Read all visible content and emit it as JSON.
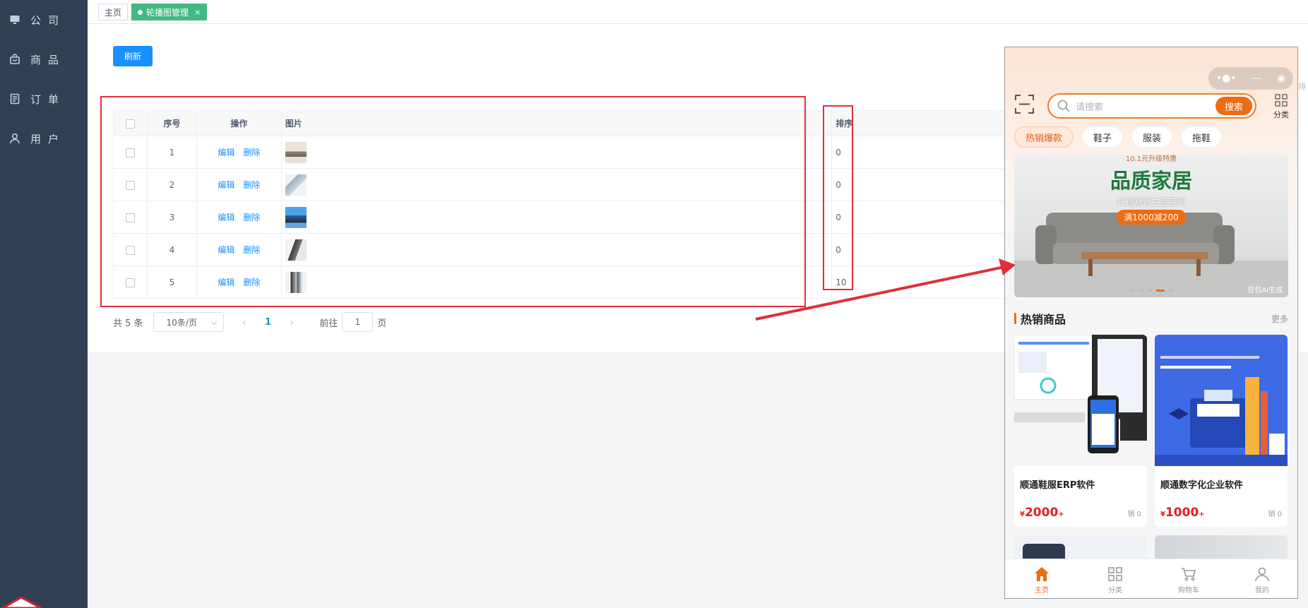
{
  "sidebar": {
    "items": [
      {
        "label": "公司",
        "icon": "monitor-icon"
      },
      {
        "label": "商品",
        "icon": "bag-icon"
      },
      {
        "label": "订单",
        "icon": "document-icon"
      },
      {
        "label": "用户",
        "icon": "user-icon"
      }
    ]
  },
  "tabs": [
    {
      "label": "主页",
      "active": false
    },
    {
      "label": "轮播图管理",
      "active": true,
      "close": "×"
    }
  ],
  "toolbar": {
    "refresh_label": "刷新"
  },
  "table": {
    "headers": {
      "index": "序号",
      "actions": "操作",
      "image": "图片",
      "sort": "排序"
    },
    "edit_label": "编辑",
    "delete_label": "删除",
    "rows": [
      {
        "index": "1",
        "sort": "0"
      },
      {
        "index": "2",
        "sort": "0"
      },
      {
        "index": "3",
        "sort": "0"
      },
      {
        "index": "4",
        "sort": "0"
      },
      {
        "index": "5",
        "sort": "10"
      }
    ]
  },
  "pagination": {
    "total": "共 5 条",
    "page_size": "10条/页",
    "current_page": "1",
    "goto_label": "前往",
    "goto_value": "1",
    "page_suffix": "页"
  },
  "phone": {
    "search_placeholder": "请搜索",
    "search_button": "搜索",
    "category_label": "分类",
    "chips": [
      "热销爆款",
      "鞋子",
      "服装",
      "拖鞋"
    ],
    "banner": {
      "small_text": "10.1元升级特惠",
      "title": "品质家居",
      "subtitle": "打造舒适生活空间",
      "tag": "满1000减200",
      "watermark": "豆包AI生成"
    },
    "section_title": "热销商品",
    "section_more": "更多",
    "products": [
      {
        "name": "顺通鞋服ERP软件",
        "price": "2000",
        "currency": "¥",
        "plus": "+",
        "sold": "销 0"
      },
      {
        "name": "顺通数字化企业软件",
        "price": "1000",
        "currency": "¥",
        "plus": "+",
        "sold": "销 0"
      }
    ],
    "tabbar": [
      "主页",
      "分类",
      "购物车",
      "我的"
    ]
  },
  "colors": {
    "sidebar_bg": "#304156",
    "accent_blue": "#1890ff",
    "tab_active": "#42b983",
    "phone_accent": "#ee6b12",
    "annotation_red": "#e02f3b"
  }
}
